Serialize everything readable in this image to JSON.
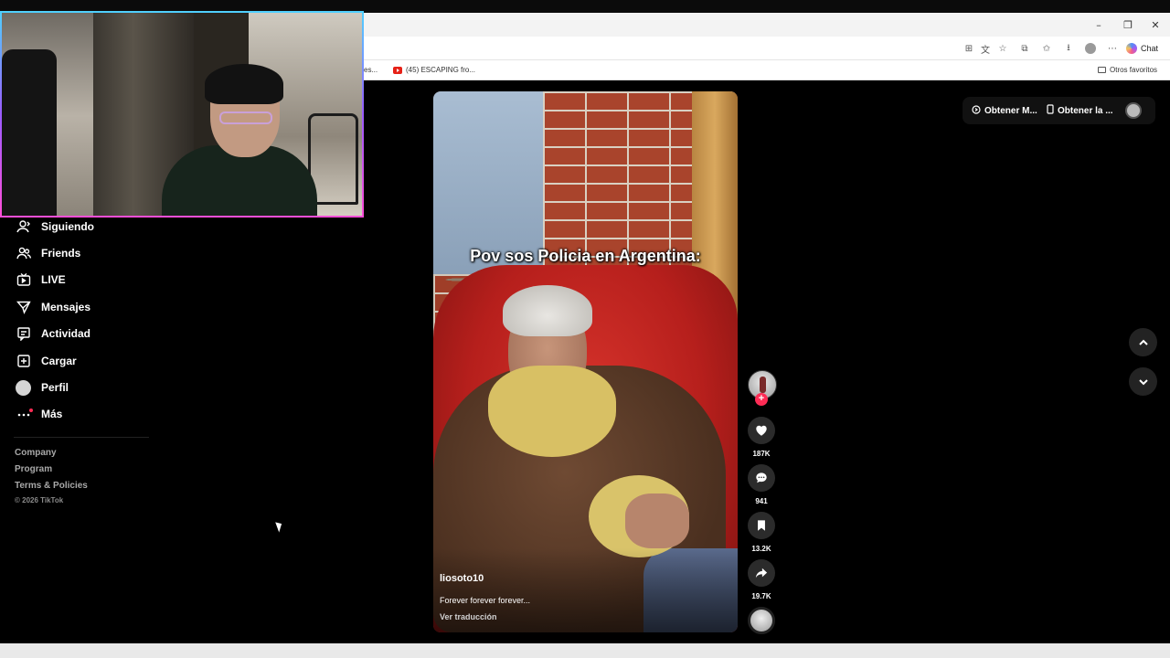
{
  "browser": {
    "window_controls": [
      "–",
      "❐",
      "✕"
    ],
    "chat_label": "Chat",
    "bookmarks": {
      "truncated_prev": "es...",
      "youtube_tab": "(45) ESCAPING fro...",
      "other_favorites": "Otros favoritos"
    }
  },
  "sidebar": {
    "items": [
      {
        "label": "Siguiendo",
        "icon": "following-icon"
      },
      {
        "label": "Friends",
        "icon": "friends-icon"
      },
      {
        "label": "LIVE",
        "icon": "live-icon"
      },
      {
        "label": "Mensajes",
        "icon": "messages-icon"
      },
      {
        "label": "Actividad",
        "icon": "activity-icon"
      },
      {
        "label": "Cargar",
        "icon": "upload-icon"
      },
      {
        "label": "Perfil",
        "icon": "profile-icon"
      },
      {
        "label": "Más",
        "icon": "more-icon"
      }
    ],
    "footer": {
      "links": [
        "Company",
        "Program",
        "Terms & Policies"
      ],
      "copyright": "© 2026 TikTok"
    }
  },
  "video": {
    "caption": "Pov sos Policia en Argentina:",
    "username": "liosoto10",
    "description": "Forever forever forever...",
    "translate": "Ver traducción"
  },
  "actions": {
    "follow_symbol": "+",
    "likes": "187K",
    "comments": "941",
    "saves": "13.2K",
    "shares": "19.7K"
  },
  "header": {
    "get_app": "Obtener M...",
    "get_app2": "Obtener la ..."
  },
  "colors": {
    "accent": "#fe2c55",
    "background": "#000000",
    "webcam_border_top": "#4fd0ff",
    "webcam_border_bottom": "#ff4fd8"
  }
}
